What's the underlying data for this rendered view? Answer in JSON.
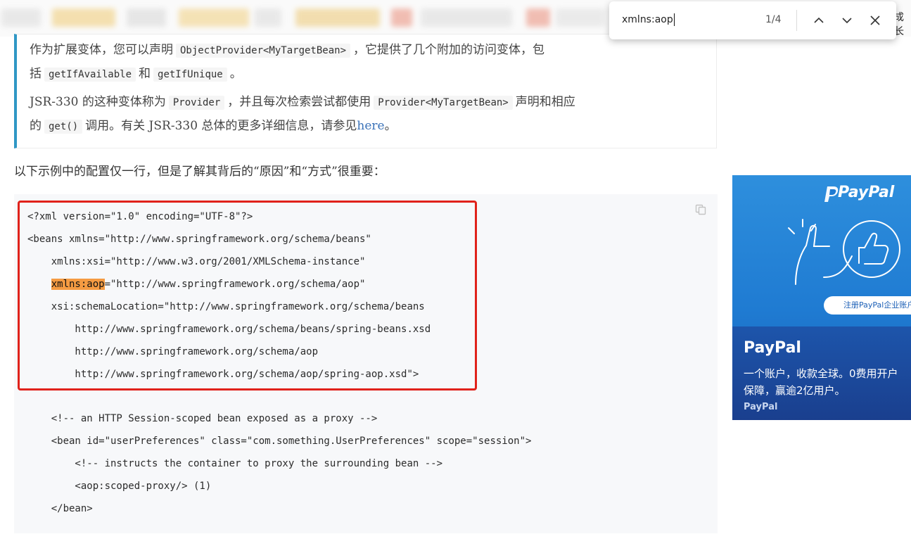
{
  "top_bar": {
    "cut_text": "成长"
  },
  "note": {
    "line1": {
      "pre": "作为扩展变体，您可以声明",
      "code": "ObjectProvider<MyTargetBean>",
      "post": "，它提供了几个附加的访问变体，包"
    },
    "line2": {
      "pre": "括",
      "code1": "getIfAvailable",
      "mid": "和",
      "code2": "getIfUnique",
      "post": "。"
    },
    "line3": {
      "pre": "JSR-330 的这种变体称为",
      "code1": "Provider",
      "mid": "，并且每次检索尝试都使用",
      "code2": "Provider<MyTargetBean>",
      "post": "声明和相应"
    },
    "line4": {
      "pre": "的",
      "code": "get()",
      "mid": "调用。有关 JSR-330 总体的更多详细信息，请参见",
      "link": "here",
      "post": "。"
    }
  },
  "paragraph": "以下示例中的配置仅一行，但是了解其背后的“原因”和“方式”很重要：",
  "code": {
    "l1": "<?xml version=\"1.0\" encoding=\"UTF-8\"?>",
    "l2": "<beans xmlns=\"http://www.springframework.org/schema/beans\"",
    "l3": "    xmlns:xsi=\"http://www.w3.org/2001/XMLSchema-instance\"",
    "l4_indent": "    ",
    "l4_hl": "xmlns:aop",
    "l4_rest": "=\"http://www.springframework.org/schema/aop\"",
    "l5": "    xsi:schemaLocation=\"http://www.springframework.org/schema/beans",
    "l6": "        http://www.springframework.org/schema/beans/spring-beans.xsd",
    "l7": "        http://www.springframework.org/schema/aop",
    "l8": "        http://www.springframework.org/schema/aop/spring-aop.xsd\">",
    "l9": "    <!-- an HTTP Session-scoped bean exposed as a proxy -->",
    "l10": "    <bean id=\"userPreferences\" class=\"com.something.UserPreferences\" scope=\"session\">",
    "l11": "        <!-- instructs the container to proxy the surrounding bean -->",
    "l12": "        <aop:scoped-proxy/> (1)",
    "l13": "    </bean>"
  },
  "find_bar": {
    "query": "xmlns:aop",
    "count": "1/4"
  },
  "ad": {
    "logo": "PayPal",
    "cta": "注册PayPal企业账户",
    "title": "PayPal",
    "line1": "一个账户，收款全球。0费用开户",
    "line2": "保障，赢逾2亿用户。",
    "brand": "PayPal"
  },
  "colors": {
    "accent_border": "#2f97c5",
    "highlight": "#f59b42",
    "red_box": "#e0221b",
    "ad_blue": "#1f7bd2"
  }
}
